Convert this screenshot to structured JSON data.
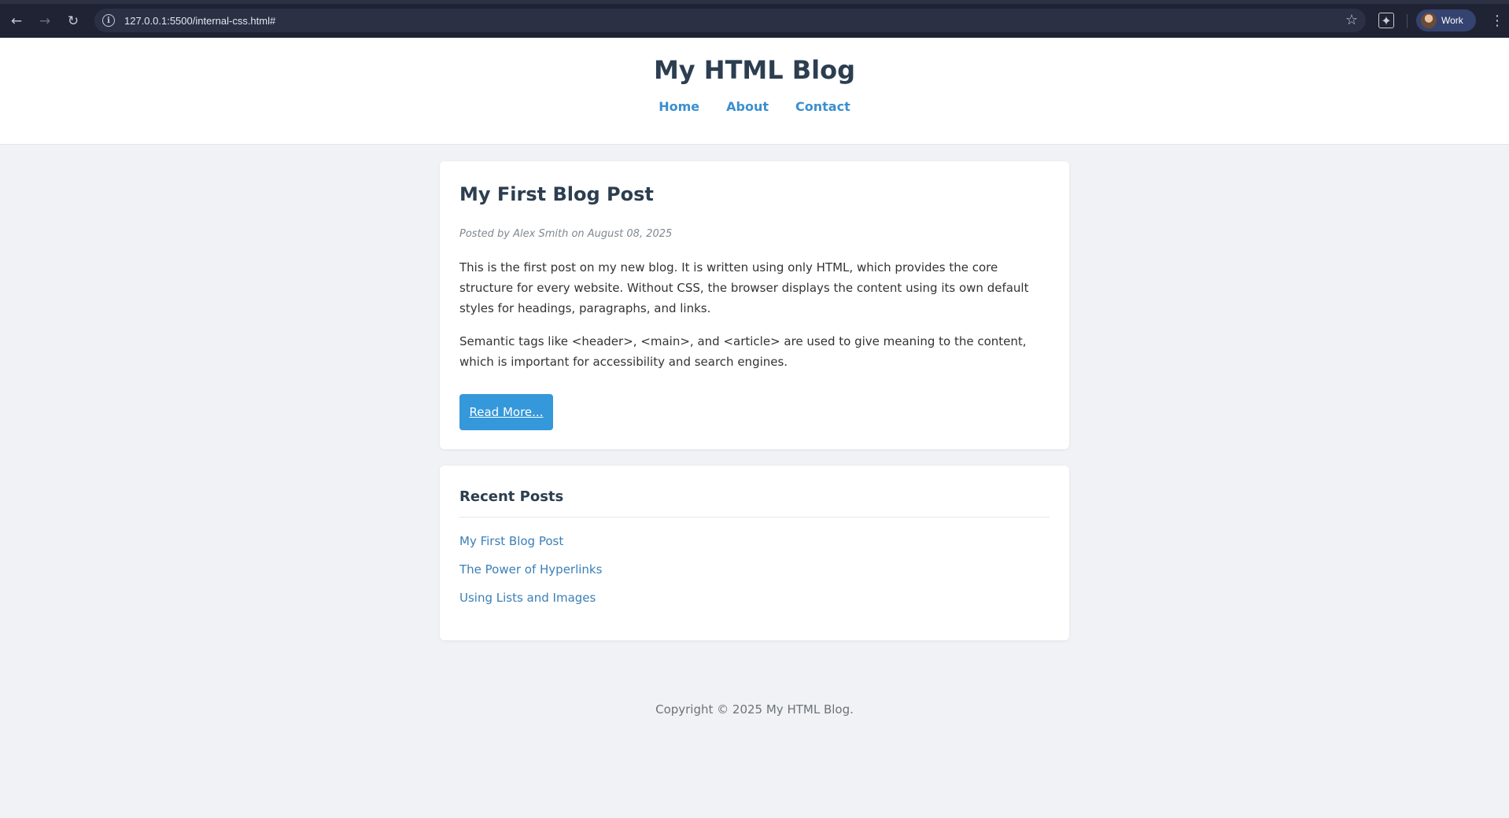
{
  "browser": {
    "url": "127.0.0.1:5500/internal-css.html#",
    "profile_name": "Work"
  },
  "header": {
    "title": "My HTML Blog",
    "nav": [
      {
        "label": "Home"
      },
      {
        "label": "About"
      },
      {
        "label": "Contact"
      }
    ]
  },
  "post": {
    "title": "My First Blog Post",
    "meta": "Posted by Alex Smith on August 08, 2025",
    "paragraphs": [
      "This is the first post on my new blog. It is written using only HTML, which provides the core structure for every website. Without CSS, the browser displays the content using its own default styles for headings, paragraphs, and links.",
      "Semantic tags like <header>, <main>, and <article> are used to give meaning to the content, which is important for accessibility and search engines."
    ],
    "read_more_label": "Read More..."
  },
  "recent": {
    "title": "Recent Posts",
    "items": [
      {
        "label": "My First Blog Post"
      },
      {
        "label": "The Power of Hyperlinks"
      },
      {
        "label": "Using Lists and Images"
      }
    ]
  },
  "footer": {
    "text": "Copyright © 2025 My HTML Blog."
  }
}
